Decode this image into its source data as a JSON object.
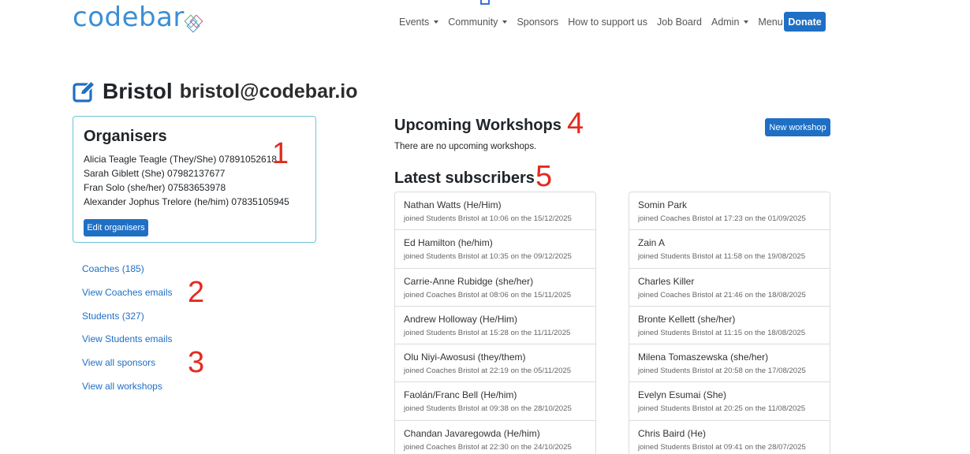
{
  "brand": {
    "logo_text": "codebar"
  },
  "nav": {
    "items": [
      {
        "label": "Events",
        "dropdown": true
      },
      {
        "label": "Community",
        "dropdown": true
      },
      {
        "label": "Sponsors",
        "dropdown": false
      },
      {
        "label": "How to support us",
        "dropdown": false
      },
      {
        "label": "Job Board",
        "dropdown": false
      },
      {
        "label": "Admin",
        "dropdown": true
      },
      {
        "label": "Menu",
        "dropdown": true
      }
    ],
    "donate_label": "Donate"
  },
  "page": {
    "title": "Bristol",
    "email": "bristol@codebar.io"
  },
  "organisers": {
    "heading": "Organisers",
    "people": [
      "Alicia Teagle Teagle (They/She) 07891052618",
      "Sarah Giblett (She) 07982137677",
      "Fran Solo (she/her) 07583653978",
      "Alexander Jophus Trelore (he/him) 07835105945"
    ],
    "edit_label": "Edit organisers"
  },
  "side_links": [
    "Coaches (185)",
    "View Coaches emails",
    "Students (327)",
    "View Students emails",
    "View all sponsors",
    "View all workshops"
  ],
  "workshops": {
    "heading": "Upcoming Workshops",
    "empty_text": "There are no upcoming workshops.",
    "new_label": "New workshop"
  },
  "subscribers": {
    "heading": "Latest subscribers",
    "left": [
      {
        "name": "Nathan Watts (He/Him)",
        "meta": "joined Students Bristol at 10:06 on the 15/12/2025"
      },
      {
        "name": "Ed Hamilton (he/him)",
        "meta": "joined Students Bristol at 10:35 on the 09/12/2025"
      },
      {
        "name": "Carrie-Anne Rubidge (she/her)",
        "meta": "joined Coaches Bristol at 08:06 on the 15/11/2025"
      },
      {
        "name": "Andrew Holloway (He/Him)",
        "meta": "joined Students Bristol at 15:28 on the 11/11/2025"
      },
      {
        "name": "Olu Niyi-Awosusi (they/them)",
        "meta": "joined Coaches Bristol at 22:19 on the 05/11/2025"
      },
      {
        "name": "Faolán/Franc Bell (He/him)",
        "meta": "joined Students Bristol at 09:38 on the 28/10/2025"
      },
      {
        "name": "Chandan Javaregowda (He/him)",
        "meta": "joined Coaches Bristol at 22:30 on the 24/10/2025"
      }
    ],
    "right": [
      {
        "name": "Somin Park",
        "meta": "joined Coaches Bristol at 17:23 on the 01/09/2025"
      },
      {
        "name": "Zain A",
        "meta": "joined Students Bristol at 11:58 on the 19/08/2025"
      },
      {
        "name": "Charles Killer",
        "meta": "joined Coaches Bristol at 21:46 on the 18/08/2025"
      },
      {
        "name": "Bronte Kellett (she/her)",
        "meta": "joined Students Bristol at 11:15 on the 18/08/2025"
      },
      {
        "name": "Milena Tomaszewska (she/her)",
        "meta": "joined Students Bristol at 20:58 on the 17/08/2025"
      },
      {
        "name": "Evelyn Esumai (She)",
        "meta": "joined Students Bristol at 20:25 on the 11/08/2025"
      },
      {
        "name": "Chris Baird (He)",
        "meta": "joined Students Bristol at 09:41 on the 28/07/2025"
      }
    ]
  },
  "annotations": [
    "1",
    "2",
    "3",
    "4",
    "5"
  ],
  "colors": {
    "accent": "#1f6fc5",
    "annotation": "#e32b1f",
    "card_border": "#6fc4d6",
    "logo": "#3a8fd6"
  }
}
